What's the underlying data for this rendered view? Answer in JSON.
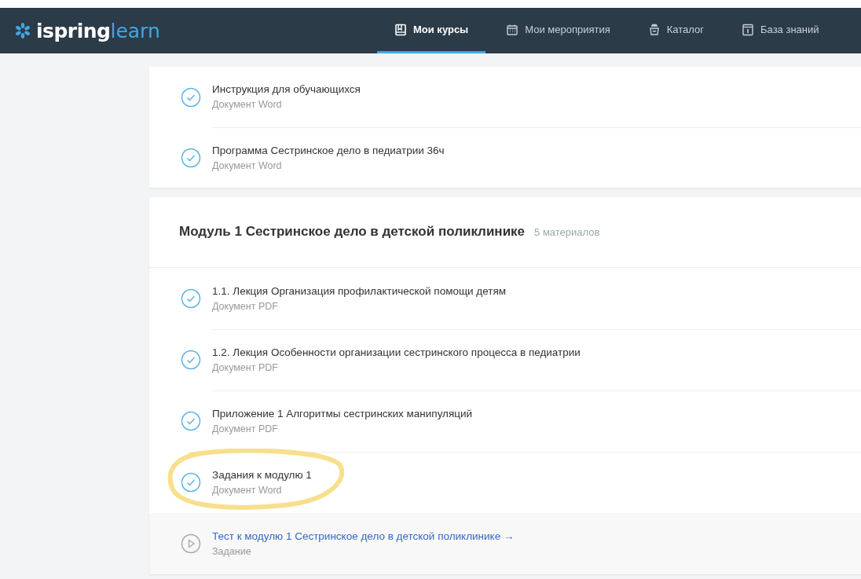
{
  "header": {
    "logo": {
      "brand": "ispring",
      "product": "learn"
    },
    "tabs": [
      {
        "label": "Мои курсы",
        "kind": "book",
        "selected": true
      },
      {
        "label": "Мои мероприятия",
        "kind": "calendar",
        "selected": false
      },
      {
        "label": "Каталог",
        "kind": "basket",
        "selected": false
      },
      {
        "label": "База знаний",
        "kind": "info",
        "selected": false
      }
    ]
  },
  "sections": [
    {
      "items": [
        {
          "kind": "done",
          "title": "Инструкция для обучающихся",
          "type": "Документ Word",
          "highlighted": false
        },
        {
          "kind": "done",
          "title": "Программа Сестринское дело в педиатрии 36ч",
          "type": "Документ Word",
          "highlighted": false
        }
      ]
    },
    {
      "title": "Модуль 1 Сестринское дело в детской поликлинике",
      "count": "5 материалов",
      "items": [
        {
          "kind": "done",
          "title": "1.1. Лекция Организация профилактической помощи детям",
          "type": "Документ PDF",
          "highlighted": false
        },
        {
          "kind": "done",
          "title": "1.2. Лекция Особенности организации сестринского процесса в педиатрии",
          "type": "Документ PDF",
          "highlighted": false
        },
        {
          "kind": "done",
          "title": "Приложение 1 Алгоритмы сестринских манипуляций",
          "type": "Документ PDF",
          "highlighted": false
        },
        {
          "kind": "done",
          "title": "Задания к модулю 1",
          "type": "Документ Word",
          "highlighted": true
        },
        {
          "kind": "task",
          "title": "Тест к модулю 1 Сестринское дело в детской поликлинике",
          "arrow": "→",
          "type": "Задание",
          "highlighted": false
        }
      ]
    }
  ]
}
